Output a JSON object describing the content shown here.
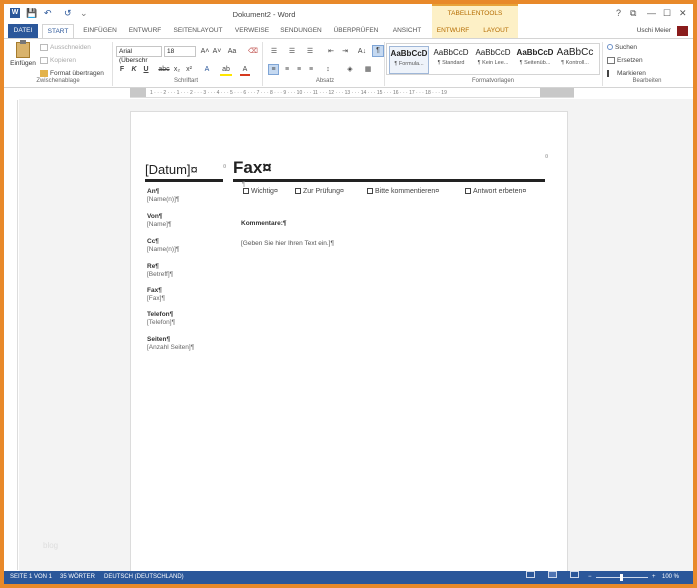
{
  "window": {
    "title": "Dokument2 - Word",
    "contextual_group": "TABELLENTOOLS",
    "user": "Uschi Meier",
    "controls": {
      "help": "?",
      "restore": "⧉",
      "minimize": "—",
      "maximize": "☐",
      "close": "✕"
    }
  },
  "quick_access": {
    "save": "💾",
    "undo": "↶",
    "redo": "↺",
    "customize": "⌄"
  },
  "tabs": [
    {
      "label": "DATEI"
    },
    {
      "label": "START"
    },
    {
      "label": "EINFÜGEN"
    },
    {
      "label": "ENTWURF"
    },
    {
      "label": "SEITENLAYOUT"
    },
    {
      "label": "VERWEISE"
    },
    {
      "label": "SENDUNGEN"
    },
    {
      "label": "ÜBERPRÜFEN"
    },
    {
      "label": "ANSICHT"
    },
    {
      "label": "ENTWURF"
    },
    {
      "label": "LAYOUT"
    }
  ],
  "ribbon": {
    "clipboard": {
      "paste": "Einfügen",
      "cut": "Ausschneiden",
      "copy": "Kopieren",
      "format_painter": "Format übertragen",
      "group": "Zwischenablage"
    },
    "font": {
      "font_name": "Arial (Überschr",
      "font_size": "18",
      "grow": "A˄",
      "shrink": "A˅",
      "case": "Aa",
      "clear": "⌫",
      "bold": "F",
      "italic": "K",
      "underline": "U",
      "strike": "abc",
      "sub": "x₂",
      "sup": "x²",
      "effects": "A",
      "highlight": "ab",
      "color": "A",
      "group": "Schriftart"
    },
    "paragraph": {
      "bullets": "☰",
      "numbering": "☰",
      "multilevel": "☰",
      "outdent": "⇤",
      "indent": "⇥",
      "sort": "A↓",
      "pilcrow": "¶",
      "align_left": "≡",
      "center": "≡",
      "align_right": "≡",
      "justify": "≡",
      "spacing": "↕",
      "shading": "◈",
      "borders": "▦",
      "group": "Absatz"
    },
    "styles": {
      "items": [
        {
          "preview": "AaBbCcD",
          "name": "¶ Formula..."
        },
        {
          "preview": "AaBbCcD",
          "name": "¶ Standard"
        },
        {
          "preview": "AaBbCcD",
          "name": "¶ Kein Lee..."
        },
        {
          "preview": "AaBbCcD",
          "name": "¶ Seitenüb..."
        },
        {
          "preview": "AaBbCc",
          "name": "¶ Kontroll..."
        }
      ],
      "group": "Formatvorlagen"
    },
    "editing": {
      "find": "Suchen",
      "replace": "Ersetzen",
      "select": "Markieren",
      "group": "Bearbeiten"
    }
  },
  "ruler": {
    "labels": "1 · · · 2 · · · 1 · · · 2 · · · 3 · · · 4 · · · 5 · · · 6 · · · 7 · · · 8 · · · 9 · · · 10 · · · 11 · · · 12 · · · 13 · · · 14 · · · 15 · · · 16 · · · 17 · · · 18 · · · 19"
  },
  "document": {
    "date": "[Datum]¤",
    "fax_title": "Fax¤",
    "fields": [
      {
        "label": "An¶",
        "value": "[Name(n)]¶"
      },
      {
        "label": "Von¶",
        "value": "[Name]¶"
      },
      {
        "label": "Cc¶",
        "value": "[Name(n)]¶"
      },
      {
        "label": "Re¶",
        "value": "[Betreff]¶"
      },
      {
        "label": "Fax¶",
        "value": "[Fax]¶"
      },
      {
        "label": "Telefon¶",
        "value": "[Telefon]¶"
      },
      {
        "label": "Seiten¶",
        "value": "[Anzahl Seiten]¶"
      }
    ],
    "checkboxes": [
      "Wichtig¤",
      "Zur Prüfung¤",
      "Bitte kommentieren¤",
      "Antwort erbeten¤"
    ],
    "comments_label": "Kommentare:¶",
    "comments_placeholder": "[Geben Sie hier Ihren Text ein.]¶",
    "watermark": "blog"
  },
  "status": {
    "page": "SEITE 1 VON 1",
    "words": "35 WÖRTER",
    "language": "DEUTSCH (DEUTSCHLAND)",
    "zoom": "100 %",
    "zoom_minus": "−",
    "zoom_plus": "+"
  }
}
